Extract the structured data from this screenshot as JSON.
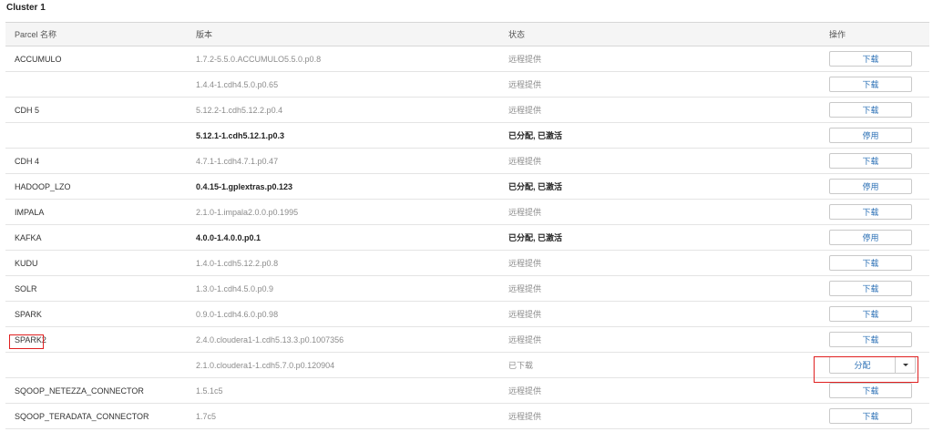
{
  "cluster": {
    "title": "Cluster 1"
  },
  "table": {
    "headers": {
      "name": "Parcel 名称",
      "version": "版本",
      "status": "状态",
      "action": "操作"
    },
    "rows": [
      {
        "name": "ACCUMULO",
        "version": "1.7.2-5.5.0.ACCUMULO5.5.0.p0.8",
        "status": "远程提供",
        "action": "下载",
        "bold": false
      },
      {
        "name": "",
        "version": "1.4.4-1.cdh4.5.0.p0.65",
        "status": "远程提供",
        "action": "下载",
        "bold": false
      },
      {
        "name": "CDH 5",
        "version": "5.12.2-1.cdh5.12.2.p0.4",
        "status": "远程提供",
        "action": "下载",
        "bold": false
      },
      {
        "name": "",
        "version": "5.12.1-1.cdh5.12.1.p0.3",
        "status": "已分配, 已激活",
        "action": "停用",
        "bold": true
      },
      {
        "name": "CDH 4",
        "version": "4.7.1-1.cdh4.7.1.p0.47",
        "status": "远程提供",
        "action": "下载",
        "bold": false
      },
      {
        "name": "HADOOP_LZO",
        "version": "0.4.15-1.gplextras.p0.123",
        "status": "已分配, 已激活",
        "action": "停用",
        "bold": true
      },
      {
        "name": "IMPALA",
        "version": "2.1.0-1.impala2.0.0.p0.1995",
        "status": "远程提供",
        "action": "下载",
        "bold": false
      },
      {
        "name": "KAFKA",
        "version": "4.0.0-1.4.0.0.p0.1",
        "status": "已分配, 已激活",
        "action": "停用",
        "bold": true
      },
      {
        "name": "KUDU",
        "version": "1.4.0-1.cdh5.12.2.p0.8",
        "status": "远程提供",
        "action": "下载",
        "bold": false
      },
      {
        "name": "SOLR",
        "version": "1.3.0-1.cdh4.5.0.p0.9",
        "status": "远程提供",
        "action": "下载",
        "bold": false
      },
      {
        "name": "SPARK",
        "version": "0.9.0-1.cdh4.6.0.p0.98",
        "status": "远程提供",
        "action": "下载",
        "bold": false
      },
      {
        "name": "SPARK2",
        "version": "2.4.0.cloudera1-1.cdh5.13.3.p0.1007356",
        "status": "远程提供",
        "action": "下载",
        "bold": false
      },
      {
        "name": "",
        "version": "2.1.0.cloudera1-1.cdh5.7.0.p0.120904",
        "status": "已下载",
        "action": "分配",
        "bold": false,
        "split": true
      },
      {
        "name": "SQOOP_NETEZZA_CONNECTOR",
        "version": "1.5.1c5",
        "status": "远程提供",
        "action": "下载",
        "bold": false
      },
      {
        "name": "SQOOP_TERADATA_CONNECTOR",
        "version": "1.7c5",
        "status": "远程提供",
        "action": "下载",
        "bold": false
      }
    ]
  },
  "colors": {
    "link": "#2a6fb5",
    "highlight": "#e02020",
    "headerBg": "#f5f5f5"
  }
}
